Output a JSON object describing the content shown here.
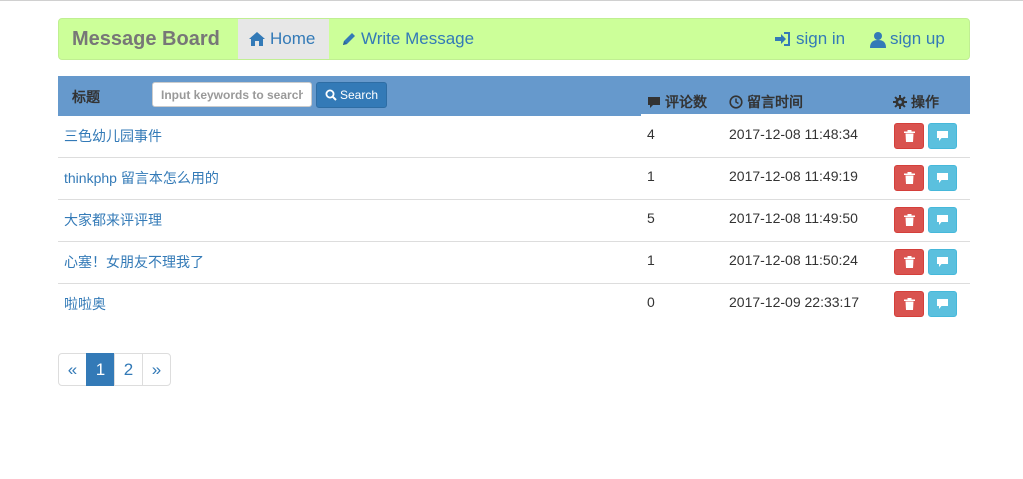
{
  "navbar": {
    "brand": "Message Board",
    "home_label": "Home",
    "write_label": "Write Message",
    "signin_label": "sign in",
    "signup_label": "sign up"
  },
  "table": {
    "header": {
      "title": "标题",
      "search_placeholder": "Input keywords to search",
      "search_button": "Search",
      "comments": "评论数",
      "time": "留言时间",
      "actions": "操作"
    },
    "rows": [
      {
        "title": "三色幼儿园事件",
        "count": "4",
        "time": "2017-12-08 11:48:34"
      },
      {
        "title": "thinkphp 留言本怎么用的",
        "count": "1",
        "time": "2017-12-08 11:49:19"
      },
      {
        "title": "大家都来评评理",
        "count": "5",
        "time": "2017-12-08 11:49:50"
      },
      {
        "title": "心塞！女朋友不理我了",
        "count": "1",
        "time": "2017-12-08 11:50:24"
      },
      {
        "title": "啦啦奥",
        "count": "0",
        "time": "2017-12-09 22:33:17"
      }
    ]
  },
  "pagination": {
    "prev": "«",
    "pages": [
      "1",
      "2"
    ],
    "next": "»",
    "current": "1"
  },
  "icons": {
    "home": "home-icon",
    "write": "pencil-icon",
    "signin": "log-in-icon",
    "signup": "user-icon",
    "search": "search-icon",
    "comment": "comment-icon",
    "time": "clock-icon",
    "actions": "cog-icon",
    "delete": "trash-icon",
    "reply": "comment-icon"
  },
  "colors": {
    "navbar_bg": "#ccff99",
    "table_header_bg": "#6699cc",
    "link": "#337ab7",
    "danger": "#d9534f",
    "info": "#5bc0de"
  }
}
